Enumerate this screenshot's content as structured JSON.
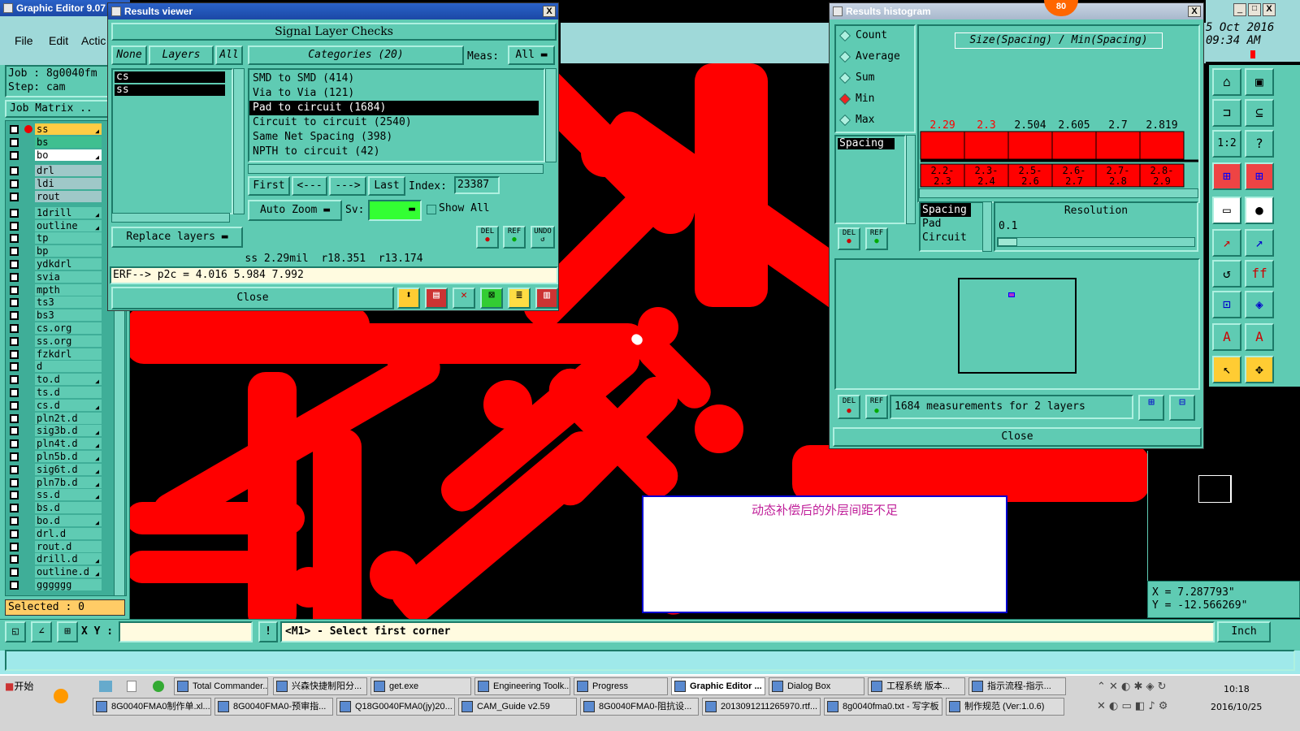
{
  "ge": {
    "title": "Graphic Editor 9.07",
    "menu": [
      "File",
      "Edit",
      "Actic"
    ],
    "job": "Job : 8g0040fm",
    "step": "Step: cam",
    "job_matrix": "Job Matrix ..",
    "selected": "Selected : 0",
    "date": "5 Oct 2016",
    "time": "09:34 AM",
    "coord_x": "X = 7.287793\"",
    "coord_y": "Y = -12.566269\"",
    "xy_label": "X Y :",
    "prompt": "<M1> - Select first corner",
    "units": "Inch"
  },
  "layers": [
    "ss",
    "bs",
    "bo",
    "drl",
    "ldi",
    "rout",
    "1drill",
    "outline",
    "tp",
    "bp",
    "ydkdrl",
    "svia",
    "mpth",
    "ts3",
    "bs3",
    "cs.org",
    "ss.org",
    "fzkdrl",
    "d",
    "to.d",
    "ts.d",
    "cs.d",
    "pln2t.d",
    "sig3b.d",
    "pln4t.d",
    "pln5b.d",
    "sig6t.d",
    "pln7b.d",
    "ss.d",
    "bs.d",
    "bo.d",
    "drl.d",
    "rout.d",
    "drill.d",
    "outline.d",
    "gggggg"
  ],
  "rv": {
    "title": "Results viewer",
    "header": "Signal Layer Checks",
    "none": "None",
    "layers_label": "Layers",
    "all": "All",
    "categories_label": "Categories (20)",
    "meas": "Meas:",
    "meas_val": "All",
    "layer_list": [
      "cs",
      "ss"
    ],
    "categories": [
      "SMD to SMD (414)",
      "Via to Via (121)",
      "Pad to circuit (1684)",
      "Circuit to circuit (2540)",
      "Same Net Spacing (398)",
      "NPTH to circuit (42)"
    ],
    "first": "First",
    "prev": "<---",
    "next": "--->",
    "last": "Last",
    "index_label": "Index:",
    "index_val": "23387",
    "auto_zoom": "Auto Zoom",
    "sv": "Sv:",
    "show_all": "Show All",
    "replace_layers": "Replace layers",
    "del": "DEL",
    "ref": "REF",
    "undo": "UNDO",
    "status": "ss 2.29mil  r18.351  r13.174",
    "erf": "ERF--> p2c = 4.016 5.984 7.992",
    "close": "Close"
  },
  "rh": {
    "title": "Results histogram",
    "badge": "80",
    "stats": [
      "Count",
      "Average",
      "Sum",
      "Min",
      "Max"
    ],
    "chart_title": "Size(Spacing) / Min(Spacing)",
    "list": [
      "Spacing"
    ],
    "group_list": [
      "Spacing",
      "Pad",
      "Circuit"
    ],
    "resolution_label": "Resolution",
    "resolution_val": "0.1",
    "footer": "1684 measurements for 2 layers",
    "close": "Close"
  },
  "chart_data": {
    "type": "bar",
    "title": "Size(Spacing) / Min(Spacing)",
    "categories": [
      "2.2-2.3",
      "2.3-2.4",
      "2.5-2.6",
      "2.6-2.7",
      "2.7-2.8",
      "2.8-2.9"
    ],
    "values": [
      2.29,
      2.3,
      2.504,
      2.605,
      2.7,
      2.819
    ],
    "value_labels": [
      "2.29",
      "2.3",
      "2.504",
      "2.605",
      "2.7",
      "2.819"
    ],
    "bin_labels": [
      [
        "2.2-",
        "2.3"
      ],
      [
        "2.3-",
        "2.4"
      ],
      [
        "2.5-",
        "2.6"
      ],
      [
        "2.6-",
        "2.7"
      ],
      [
        "2.7-",
        "2.8"
      ],
      [
        "2.8-",
        "2.9"
      ]
    ],
    "highlight": [
      "#ff0000",
      "#000000"
    ]
  },
  "note": {
    "text": "动态补偿后的外层间距不足"
  },
  "taskbar": {
    "start": "开始",
    "row1": [
      "Total Commander...",
      "兴森快捷制阳分...",
      "get.exe",
      "Engineering Toolk...",
      "Progress",
      "Graphic Editor ...",
      "Dialog Box",
      "工程系统 版本...",
      "指示流程-指示..."
    ],
    "row2": [
      "8G0040FMA0制作单.xl...",
      "8G0040FMA0-预审指...",
      "Q18G0040FMA0(jy)20...",
      "CAM_Guide v2.59",
      "8G0040FMA0-阻抗设...",
      "2013091211265970.rtf...",
      "8g0040fma0.txt - 写字板",
      "制作规范 (Ver:1.0.6)"
    ],
    "clock_time": "10:18",
    "clock_date": "2016/10/25"
  },
  "colors": {
    "teal": "#5fcbb3",
    "copper": "#ff0000",
    "title_bar": "#2a62c8"
  }
}
